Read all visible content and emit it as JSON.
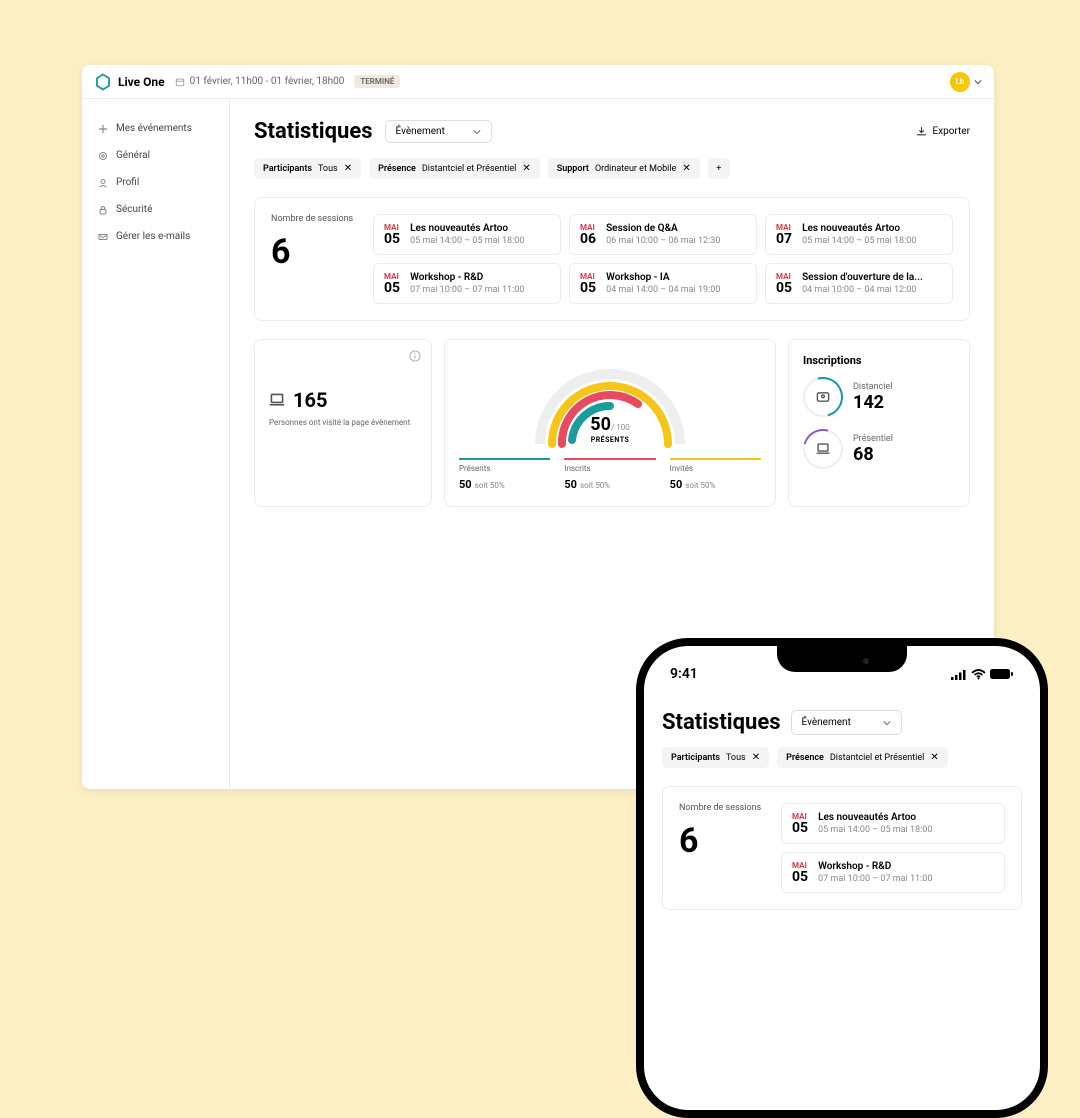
{
  "app": {
    "name": "Live One"
  },
  "topbar": {
    "date_range": "01 février, 11h00 - 01 février, 18h00",
    "status_badge": "TERMINÉ",
    "avatar_initials": "Lb"
  },
  "sidebar": {
    "items": [
      {
        "label": "Mes événements"
      },
      {
        "label": "Général"
      },
      {
        "label": "Profil"
      },
      {
        "label": "Sécurité"
      },
      {
        "label": "Gérer les e-mails"
      }
    ]
  },
  "page": {
    "title": "Statistiques",
    "scope_select": "Évènement",
    "export_label": "Exporter"
  },
  "filters": [
    {
      "label": "Participants",
      "value": "Tous"
    },
    {
      "label": "Présence",
      "value": "Distantciel et Présentiel"
    },
    {
      "label": "Support",
      "value": "Ordinateur et Mobile"
    }
  ],
  "sessions": {
    "count_label": "Nombre de sessions",
    "count": "6",
    "items": [
      {
        "month": "MAI",
        "day": "05",
        "title": "Les nouveautés Artoo",
        "time": "05 mai 14:00  –  05 mai 18:00"
      },
      {
        "month": "MAI",
        "day": "06",
        "title": "Session de Q&A",
        "time": "06 mai 10:00  –  06 mai 12:30"
      },
      {
        "month": "MAI",
        "day": "07",
        "title": "Les nouveautés Artoo",
        "time": "05 mai 14:00  –  05 mai 18:00"
      },
      {
        "month": "MAI",
        "day": "05",
        "title": "Workshop - R&D",
        "time": "07 mai 10:00  –  07 mai 11:00"
      },
      {
        "month": "MAI",
        "day": "05",
        "title": "Workshop - IA",
        "time": "04 mai 14:00  –  04 mai 19:00"
      },
      {
        "month": "MAI",
        "day": "05",
        "title": "Session d'ouverture de la...",
        "time": "04 mai 10:00  –  04 mai 12:00"
      }
    ]
  },
  "visited": {
    "count": "165",
    "desc": "Personnes ont visité la page évènement"
  },
  "gauge": {
    "value": "50",
    "total": "/ 100",
    "label": "PRÉSENTS",
    "legend": [
      {
        "name": "Présents",
        "val": "50",
        "pct": "soit 50%",
        "color": "#1a9c9c"
      },
      {
        "name": "Inscrits",
        "val": "50",
        "pct": "soit 50%",
        "color": "#e84a5f"
      },
      {
        "name": "Invités",
        "val": "50",
        "pct": "soit 50%",
        "color": "#f5c518"
      }
    ]
  },
  "inscriptions": {
    "title": "Inscriptions",
    "items": [
      {
        "label": "Distanciel",
        "count": "142"
      },
      {
        "label": "Présentiel",
        "count": "68"
      }
    ]
  },
  "phone": {
    "time": "9:41",
    "title": "Statistiques",
    "scope_select": "Évènement",
    "filters": [
      {
        "label": "Participants",
        "value": "Tous"
      },
      {
        "label": "Présence",
        "value": "Distantciel et Présentiel"
      }
    ],
    "sessions_count_label": "Nombre de sessions",
    "sessions_count": "6",
    "sessions": [
      {
        "month": "MAI",
        "day": "05",
        "title": "Les nouveautés Artoo",
        "time": "05 mai 14:00  –  05 mai 18:00"
      },
      {
        "month": "MAI",
        "day": "05",
        "title": "Workshop - R&D",
        "time": "07 mai 10:00  –  07 mai 11:00"
      }
    ]
  }
}
